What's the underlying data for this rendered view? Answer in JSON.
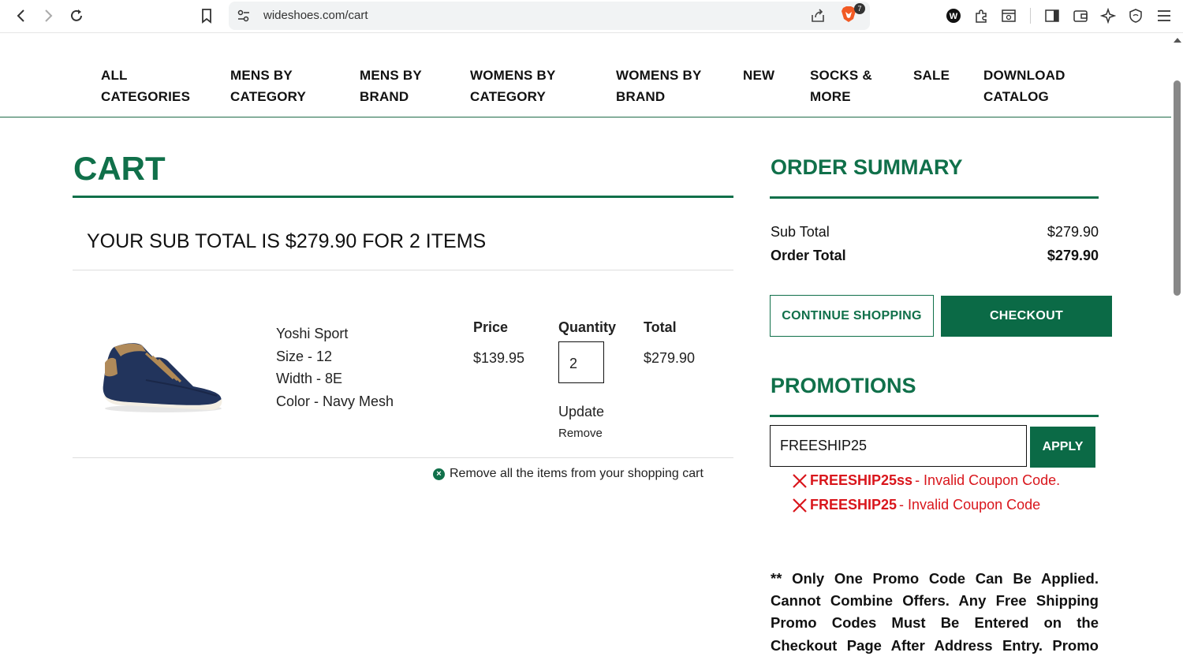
{
  "browser": {
    "url": "wideshoes.com/cart",
    "brave_badge": "7"
  },
  "nav": {
    "items": [
      "ALL\nCATEGORIES",
      "MENS BY\nCATEGORY",
      "MENS BY\nBRAND",
      "WOMENS BY\nCATEGORY",
      "WOMENS BY\nBRAND",
      "NEW",
      "SOCKS &\nMORE",
      "SALE",
      "DOWNLOAD\nCATALOG"
    ]
  },
  "cart": {
    "title": "CART",
    "subtotal_line": "YOUR SUB TOTAL IS $279.90 FOR 2 ITEMS",
    "item": {
      "name": "Yoshi Sport",
      "size": "Size - 12",
      "width": "Width - 8E",
      "color": "Color - Navy Mesh",
      "price_label": "Price",
      "price": "$139.95",
      "quantity_label": "Quantity",
      "quantity": "2",
      "total_label": "Total",
      "total": "$279.90",
      "update": "Update",
      "remove": "Remove"
    },
    "remove_all": "Remove all the items from your shopping cart"
  },
  "summary": {
    "title": "ORDER SUMMARY",
    "sub_total_label": "Sub Total",
    "sub_total": "$279.90",
    "order_total_label": "Order Total",
    "order_total": "$279.90",
    "continue_label": "CONTINUE SHOPPING",
    "checkout_label": "CHECKOUT"
  },
  "promotions": {
    "title": "PROMOTIONS",
    "input_value": "FREESHIP25",
    "apply_label": "APPLY",
    "errors": [
      {
        "code": "FREESHIP25ss",
        "message": " - Invalid Coupon Code."
      },
      {
        "code": "FREESHIP25",
        "message": " - Invalid Coupon Code"
      }
    ],
    "note": "** Only One Promo Code Can Be Applied. Cannot Combine Offers. Any Free Shipping Promo Codes Must Be Entered on the Checkout Page After Address Entry. Promo codes cannot be applied"
  },
  "colors": {
    "brand_green": "#10704a",
    "error_red": "#d9161c"
  }
}
